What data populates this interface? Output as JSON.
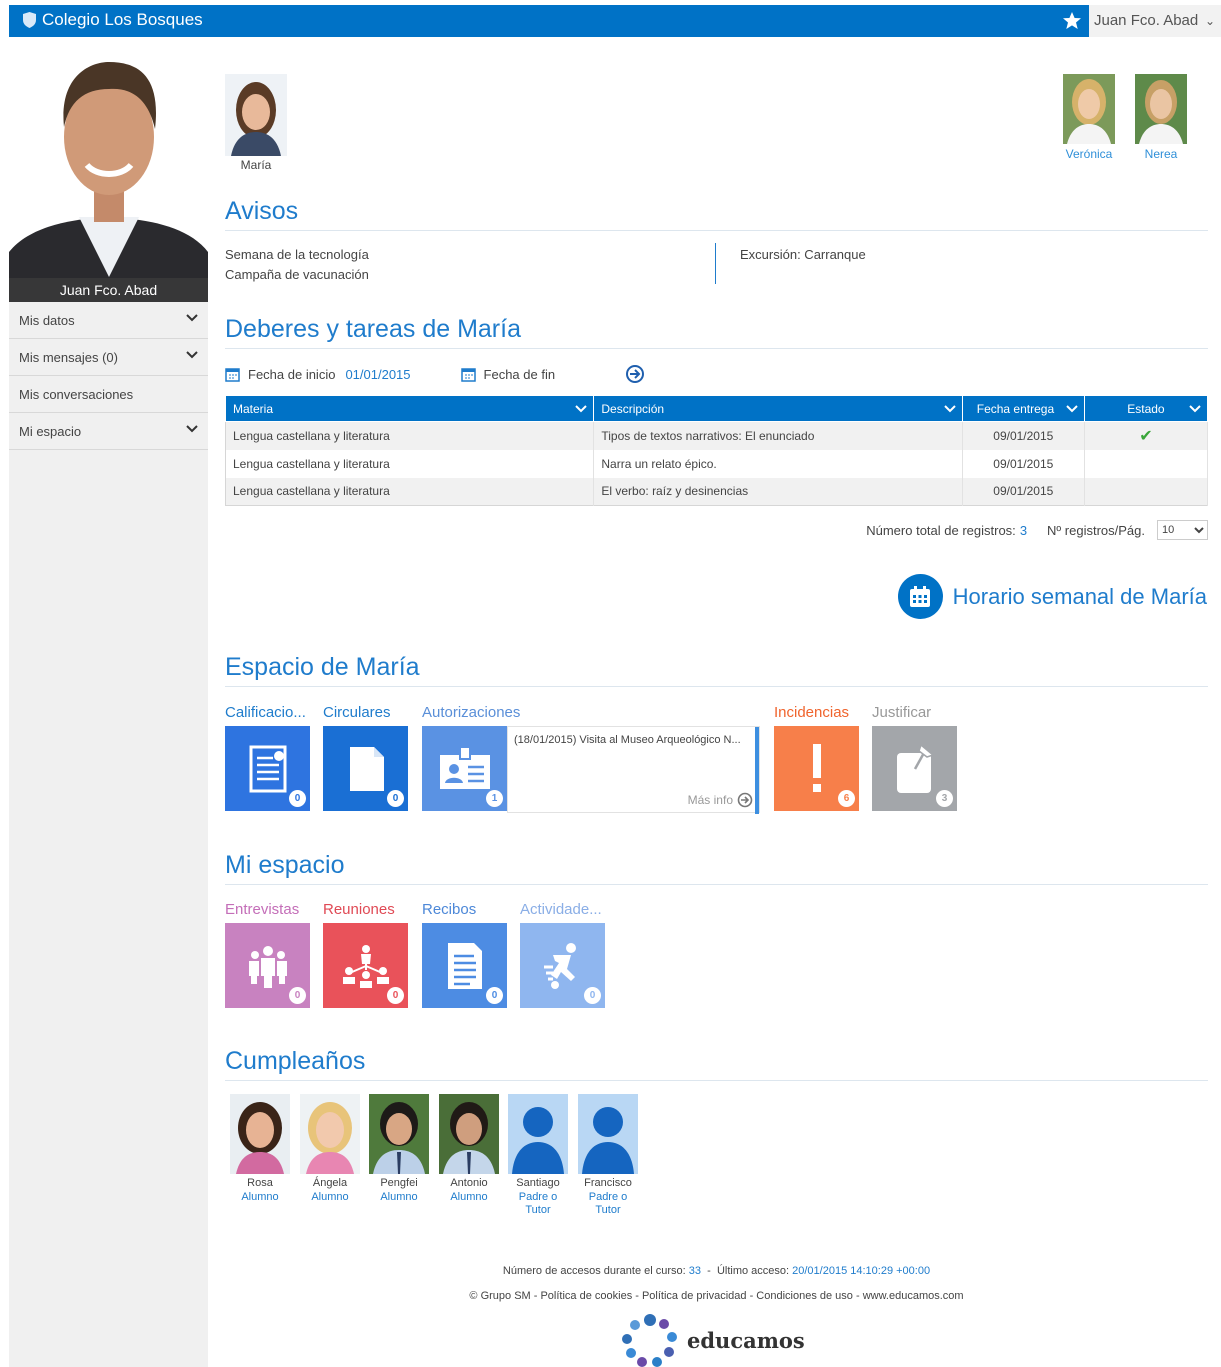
{
  "topbar": {
    "brand": "Colegio Los Bosques",
    "user": "Juan Fco. Abad"
  },
  "sidebar": {
    "profile_name": "Juan Fco. Abad",
    "items": [
      {
        "label": "Mis datos",
        "expandable": true
      },
      {
        "label": "Mis mensajes (0)",
        "expandable": true
      },
      {
        "label": "Mis conversaciones",
        "expandable": false
      },
      {
        "label": "Mi espacio",
        "expandable": true
      }
    ]
  },
  "children": {
    "selected": "María",
    "siblings": [
      "Verónica",
      "Nerea"
    ]
  },
  "avisos": {
    "title": "Avisos",
    "left": [
      "Semana de la tecnología",
      "Campaña de vacunación"
    ],
    "right": [
      "Excursión: Carranque"
    ]
  },
  "deberes": {
    "title": "Deberes y tareas de María",
    "start_label": "Fecha de inicio",
    "start_value": "01/01/2015",
    "end_label": "Fecha de fin",
    "columns": [
      "Materia",
      "Descripción",
      "Fecha entrega",
      "Estado"
    ],
    "rows": [
      {
        "materia": "Lengua castellana y literatura",
        "descripcion": "Tipos de textos narrativos: El enunciado",
        "fecha": "09/01/2015",
        "estado": "✔"
      },
      {
        "materia": "Lengua castellana y literatura",
        "descripcion": "Narra un relato épico.",
        "fecha": "09/01/2015",
        "estado": ""
      },
      {
        "materia": "Lengua castellana y literatura",
        "descripcion": "El verbo: raíz y desinencias",
        "fecha": "09/01/2015",
        "estado": ""
      }
    ],
    "total_label": "Número total de registros:",
    "total_value": "3",
    "per_page_label": "Nº registros/Pág.",
    "per_page_value": "10"
  },
  "horario": {
    "label": "Horario semanal de María"
  },
  "espacio": {
    "title": "Espacio de María",
    "tiles": [
      {
        "label": "Calificacio...",
        "count": "0",
        "color": "#2e74e0",
        "label_color": "#1f7ccc"
      },
      {
        "label": "Circulares",
        "count": "0",
        "color": "#1a6fd4",
        "label_color": "#1f7ccc"
      },
      {
        "label": "Autorizaciones",
        "count": "1",
        "color": "#5a92e3",
        "label_color": "#5a8fd8"
      },
      {
        "label": "Incidencias",
        "count": "6",
        "color": "#f77f4a",
        "label_color": "#f0642d"
      },
      {
        "label": "Justificar",
        "count": "3",
        "color": "#a3a6aa",
        "label_color": "#999999"
      }
    ],
    "auth_text": "(18/01/2015) Visita al Museo Arqueológico N...",
    "more_label": "Más info"
  },
  "mi_espacio": {
    "title": "Mi espacio",
    "tiles": [
      {
        "label": "Entrevistas",
        "count": "0",
        "color": "#c882c0",
        "label_color": "#c46eb8"
      },
      {
        "label": "Reuniones",
        "count": "0",
        "color": "#e9525a",
        "label_color": "#e04a55"
      },
      {
        "label": "Recibos",
        "count": "0",
        "color": "#4d8ce3",
        "label_color": "#4d88d8"
      },
      {
        "label": "Actividade...",
        "count": "0",
        "color": "#8fb6ef",
        "label_color": "#8aaee6"
      }
    ]
  },
  "cumpleanos": {
    "title": "Cumpleaños",
    "people": [
      {
        "name": "Rosa",
        "role": "Alumno"
      },
      {
        "name": "Ángela",
        "role": "Alumno"
      },
      {
        "name": "Pengfei",
        "role": "Alumno"
      },
      {
        "name": "Antonio",
        "role": "Alumno"
      },
      {
        "name": "Santiago",
        "role": "Padre o Tutor"
      },
      {
        "name": "Francisco",
        "role": "Padre o Tutor"
      }
    ]
  },
  "footer": {
    "accesses_label": "Número de accesos durante el curso:",
    "accesses_value": "33",
    "last_label": "Último acceso:",
    "last_value": "20/01/2015 14:10:29 +00:00",
    "links": "© Grupo SM - Política de cookies - Política de privacidad - Condiciones de uso - www.educamos.com",
    "logo": "educamos"
  }
}
